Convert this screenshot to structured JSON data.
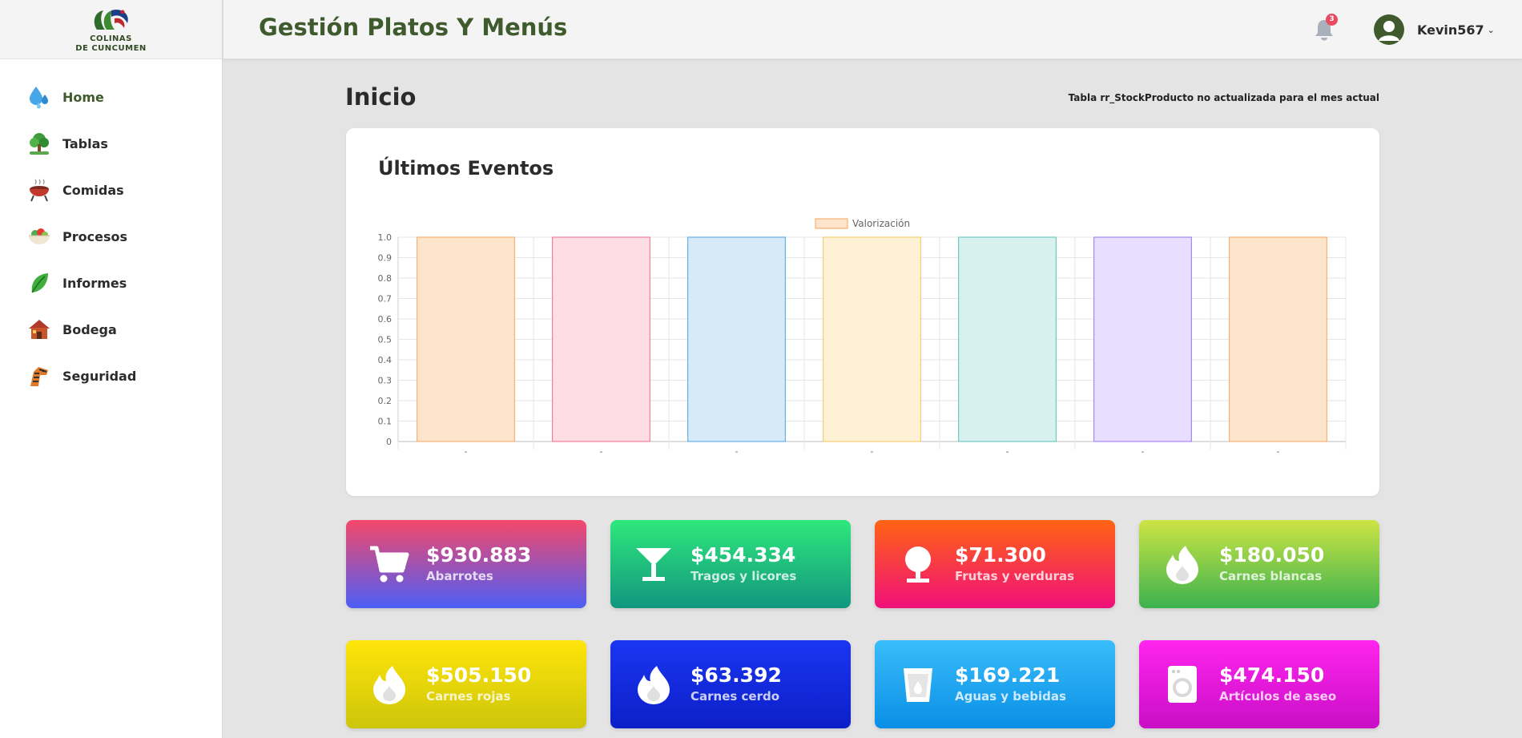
{
  "brand": {
    "logo_lines": [
      "COLINAS",
      "DE CUNCUMEN"
    ]
  },
  "sidebar": {
    "items": [
      {
        "label": "Home",
        "icon": "water-drops-icon",
        "active": true
      },
      {
        "label": "Tablas",
        "icon": "tree-icon"
      },
      {
        "label": "Comidas",
        "icon": "grill-icon"
      },
      {
        "label": "Procesos",
        "icon": "salad-bowl-icon"
      },
      {
        "label": "Informes",
        "icon": "leaf-icon"
      },
      {
        "label": "Bodega",
        "icon": "house-icon"
      },
      {
        "label": "Seguridad",
        "icon": "zebra-icon"
      }
    ]
  },
  "header": {
    "title": "Gestión Platos Y Menús",
    "notification_count": "3",
    "user_name": "Kevin567",
    "caret": "⌄"
  },
  "main": {
    "page_title": "Inicio",
    "notice": "Tabla rr_StockProducto no actualizada para el mes actual",
    "events_card": {
      "title": "Últimos Eventos"
    }
  },
  "chart_data": {
    "type": "bar",
    "legend": [
      "Valorización"
    ],
    "legend_position": "top-center",
    "categories": [
      "-",
      "-",
      "-",
      "-",
      "-",
      "-",
      "-"
    ],
    "series": [
      {
        "name": "Valorización",
        "values": [
          1,
          1,
          1,
          1,
          1,
          1,
          1
        ]
      }
    ],
    "ylim": [
      0,
      1.0
    ],
    "yticks": [
      "0",
      "0.1",
      "0.2",
      "0.3",
      "0.4",
      "0.5",
      "0.6",
      "0.7",
      "0.8",
      "0.9",
      "1.0"
    ],
    "grid": true,
    "bar_fill_colors": [
      "#fde5cc",
      "#ffdde4",
      "#d6eaf7",
      "#fff1d6",
      "#d7f1ef",
      "#e8deff",
      "#fde5cc"
    ],
    "bar_border_colors": [
      "#f7a35c",
      "#f06a8a",
      "#4da3e0",
      "#f5c55b",
      "#57c0b8",
      "#9a72f0",
      "#f7a35c"
    ]
  },
  "tiles": [
    {
      "value": "$930.883",
      "label": "Abarrotes",
      "icon": "shopping-cart-icon",
      "from": "#f5476a",
      "to": "#4c5ef5"
    },
    {
      "value": "$454.334",
      "label": "Tragos y licores",
      "icon": "cocktail-glass-icon",
      "from": "#2fe87c",
      "to": "#12967f"
    },
    {
      "value": "$71.300",
      "label": "Frutas y verduras",
      "icon": "tree-icon",
      "from": "#ff6413",
      "to": "#f0107a"
    },
    {
      "value": "$180.050",
      "label": "Carnes blancas",
      "icon": "flame-icon",
      "from": "#cde445",
      "to": "#3cb24e"
    },
    {
      "value": "$505.150",
      "label": "Carnes rojas",
      "icon": "flame-icon",
      "from": "#ffe50a",
      "to": "#cdc50a"
    },
    {
      "value": "$63.392",
      "label": "Carnes cerdo",
      "icon": "flame-icon",
      "from": "#1b36f2",
      "to": "#0c1fc8"
    },
    {
      "value": "$169.221",
      "label": "Aguas y bebidas",
      "icon": "water-glass-icon",
      "from": "#39bdfa",
      "to": "#0a8fe6"
    },
    {
      "value": "$474.150",
      "label": "Artículos de aseo",
      "icon": "washing-machine-icon",
      "from": "#ff24ee",
      "to": "#c90fc6"
    }
  ]
}
